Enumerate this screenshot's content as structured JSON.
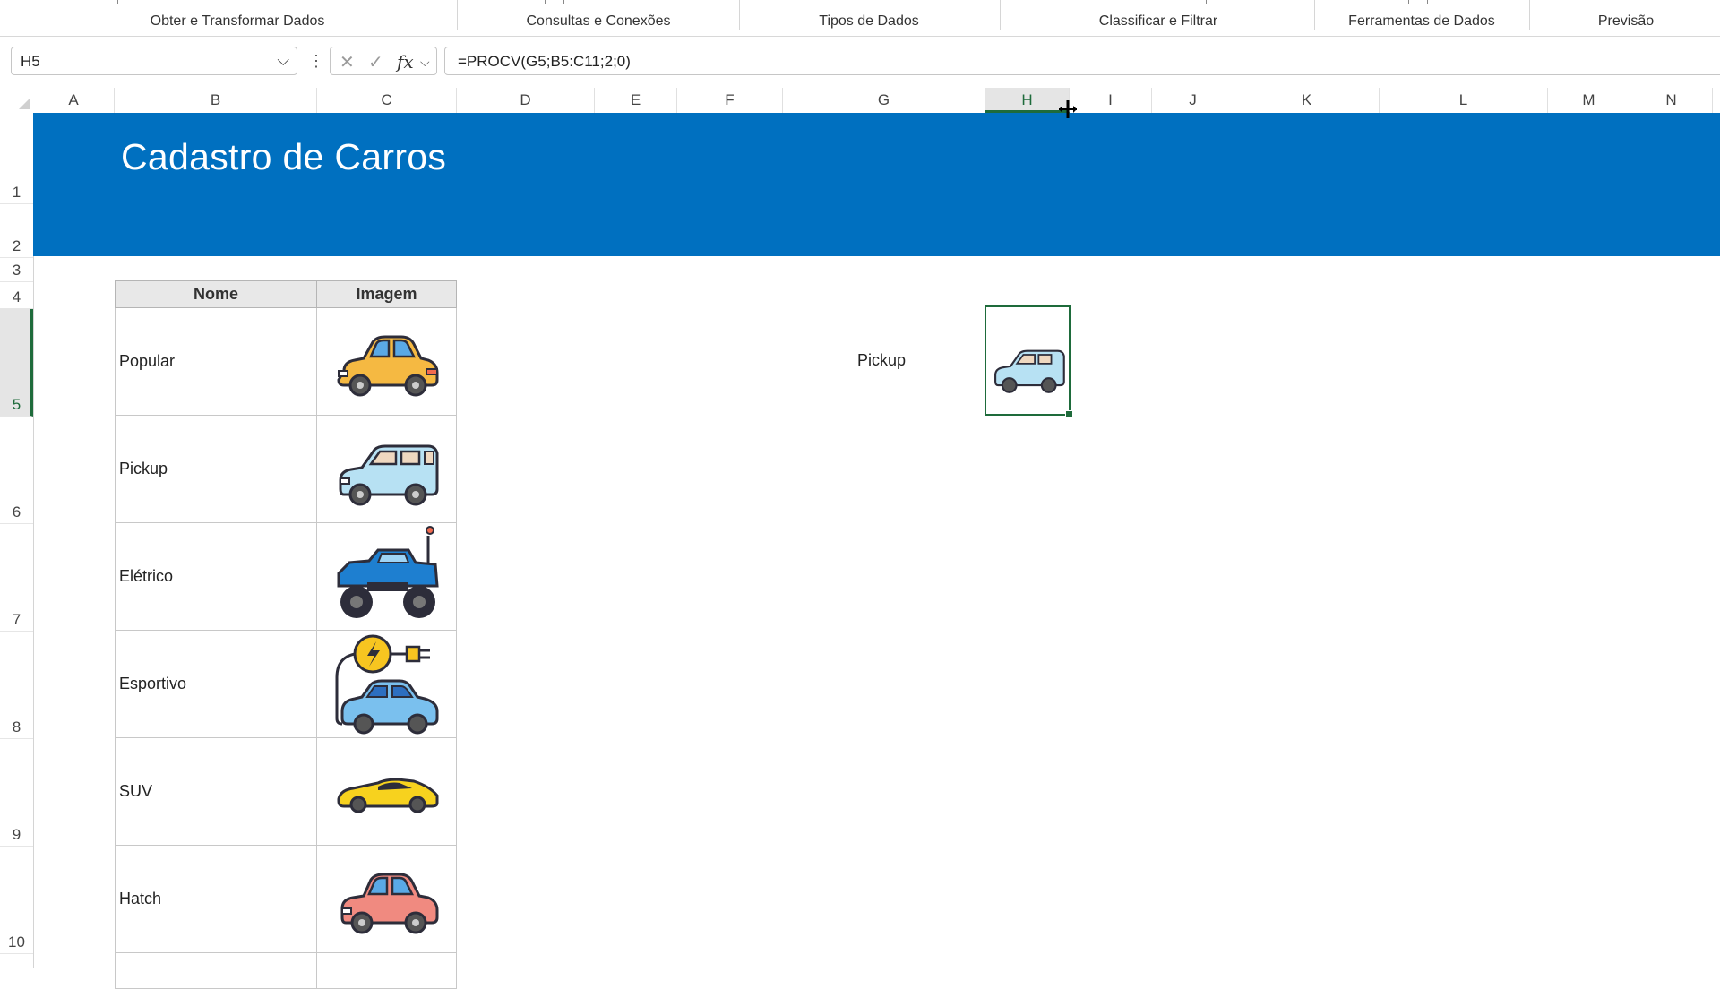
{
  "ribbon": {
    "groups": [
      "Obter e Transformar Dados",
      "Consultas e Conexões",
      "Tipos de Dados",
      "Classificar e Filtrar",
      "Ferramentas de Dados",
      "Previsão"
    ]
  },
  "formula_bar": {
    "name_box": "H5",
    "cancel_icon": "x-icon",
    "enter_icon": "check-icon",
    "fx_label": "fx",
    "formula": "=PROCV(G5;B5:C11;2;0)"
  },
  "grid": {
    "columns": [
      "A",
      "B",
      "C",
      "D",
      "E",
      "F",
      "G",
      "H",
      "I",
      "J",
      "K",
      "L",
      "M",
      "N"
    ],
    "rows": [
      "1",
      "2",
      "3",
      "4",
      "5",
      "6",
      "7",
      "8",
      "9",
      "10"
    ],
    "selected_column": "H",
    "selected_row": "5"
  },
  "sheet": {
    "title": "Cadastro de Carros",
    "table": {
      "headers": [
        "Nome",
        "Imagem"
      ],
      "rows": [
        {
          "name": "Popular",
          "icon": "yellow-car-icon"
        },
        {
          "name": "Pickup",
          "icon": "light-blue-car-icon"
        },
        {
          "name": "Elétrico",
          "icon": "blue-monster-truck-icon"
        },
        {
          "name": "Esportivo",
          "icon": "electric-car-plug-icon"
        },
        {
          "name": "SUV",
          "icon": "yellow-sports-car-icon"
        },
        {
          "name": "Hatch",
          "icon": "red-car-icon"
        }
      ]
    },
    "lookup_value": "Pickup",
    "result_icon": "light-blue-car-icon"
  },
  "colors": {
    "banner": "#0070c0",
    "selection": "#1e6b3b",
    "yellow_car": "#f5b942",
    "light_blue_car": "#b7e1f3",
    "blue_truck": "#1e7fd0",
    "electric_car": "#7ac0ee",
    "sports_car": "#f7d21e",
    "red_car": "#f08a80"
  }
}
